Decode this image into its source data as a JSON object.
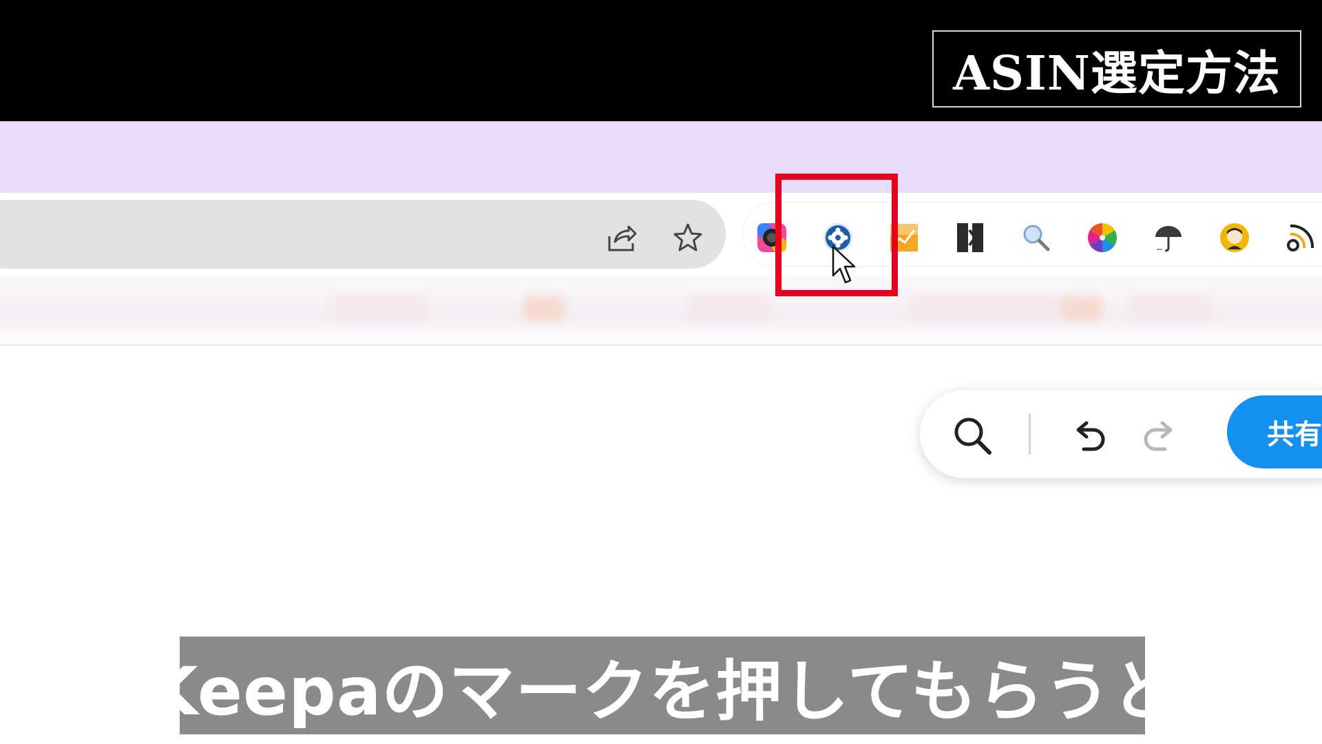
{
  "overlay": {
    "title": "ASIN選定方法",
    "subtitle": "Keepaのマークを押してもらうと"
  },
  "browser": {
    "address_bar_icons": [
      "share-icon",
      "bookmark-star-icon"
    ],
    "extensions": [
      {
        "name": "camera-color-extension-icon"
      },
      {
        "name": "keepa-extension-icon",
        "highlighted": true
      },
      {
        "name": "chart-extension-icon"
      },
      {
        "name": "bracket-extension-icon"
      },
      {
        "name": "magnifier-extension-icon"
      },
      {
        "name": "color-wheel-extension-icon"
      },
      {
        "name": "umbrella-extension-icon"
      },
      {
        "name": "avatar-extension-icon"
      },
      {
        "name": "feed-extension-icon"
      }
    ]
  },
  "doc_toolbar": {
    "share_label": "共有"
  },
  "colors": {
    "highlight": "#e8001c",
    "tab_strip": "#e9dcfb",
    "share_button": "#1490f0",
    "subtitle_bg": "#8a8a8a"
  }
}
